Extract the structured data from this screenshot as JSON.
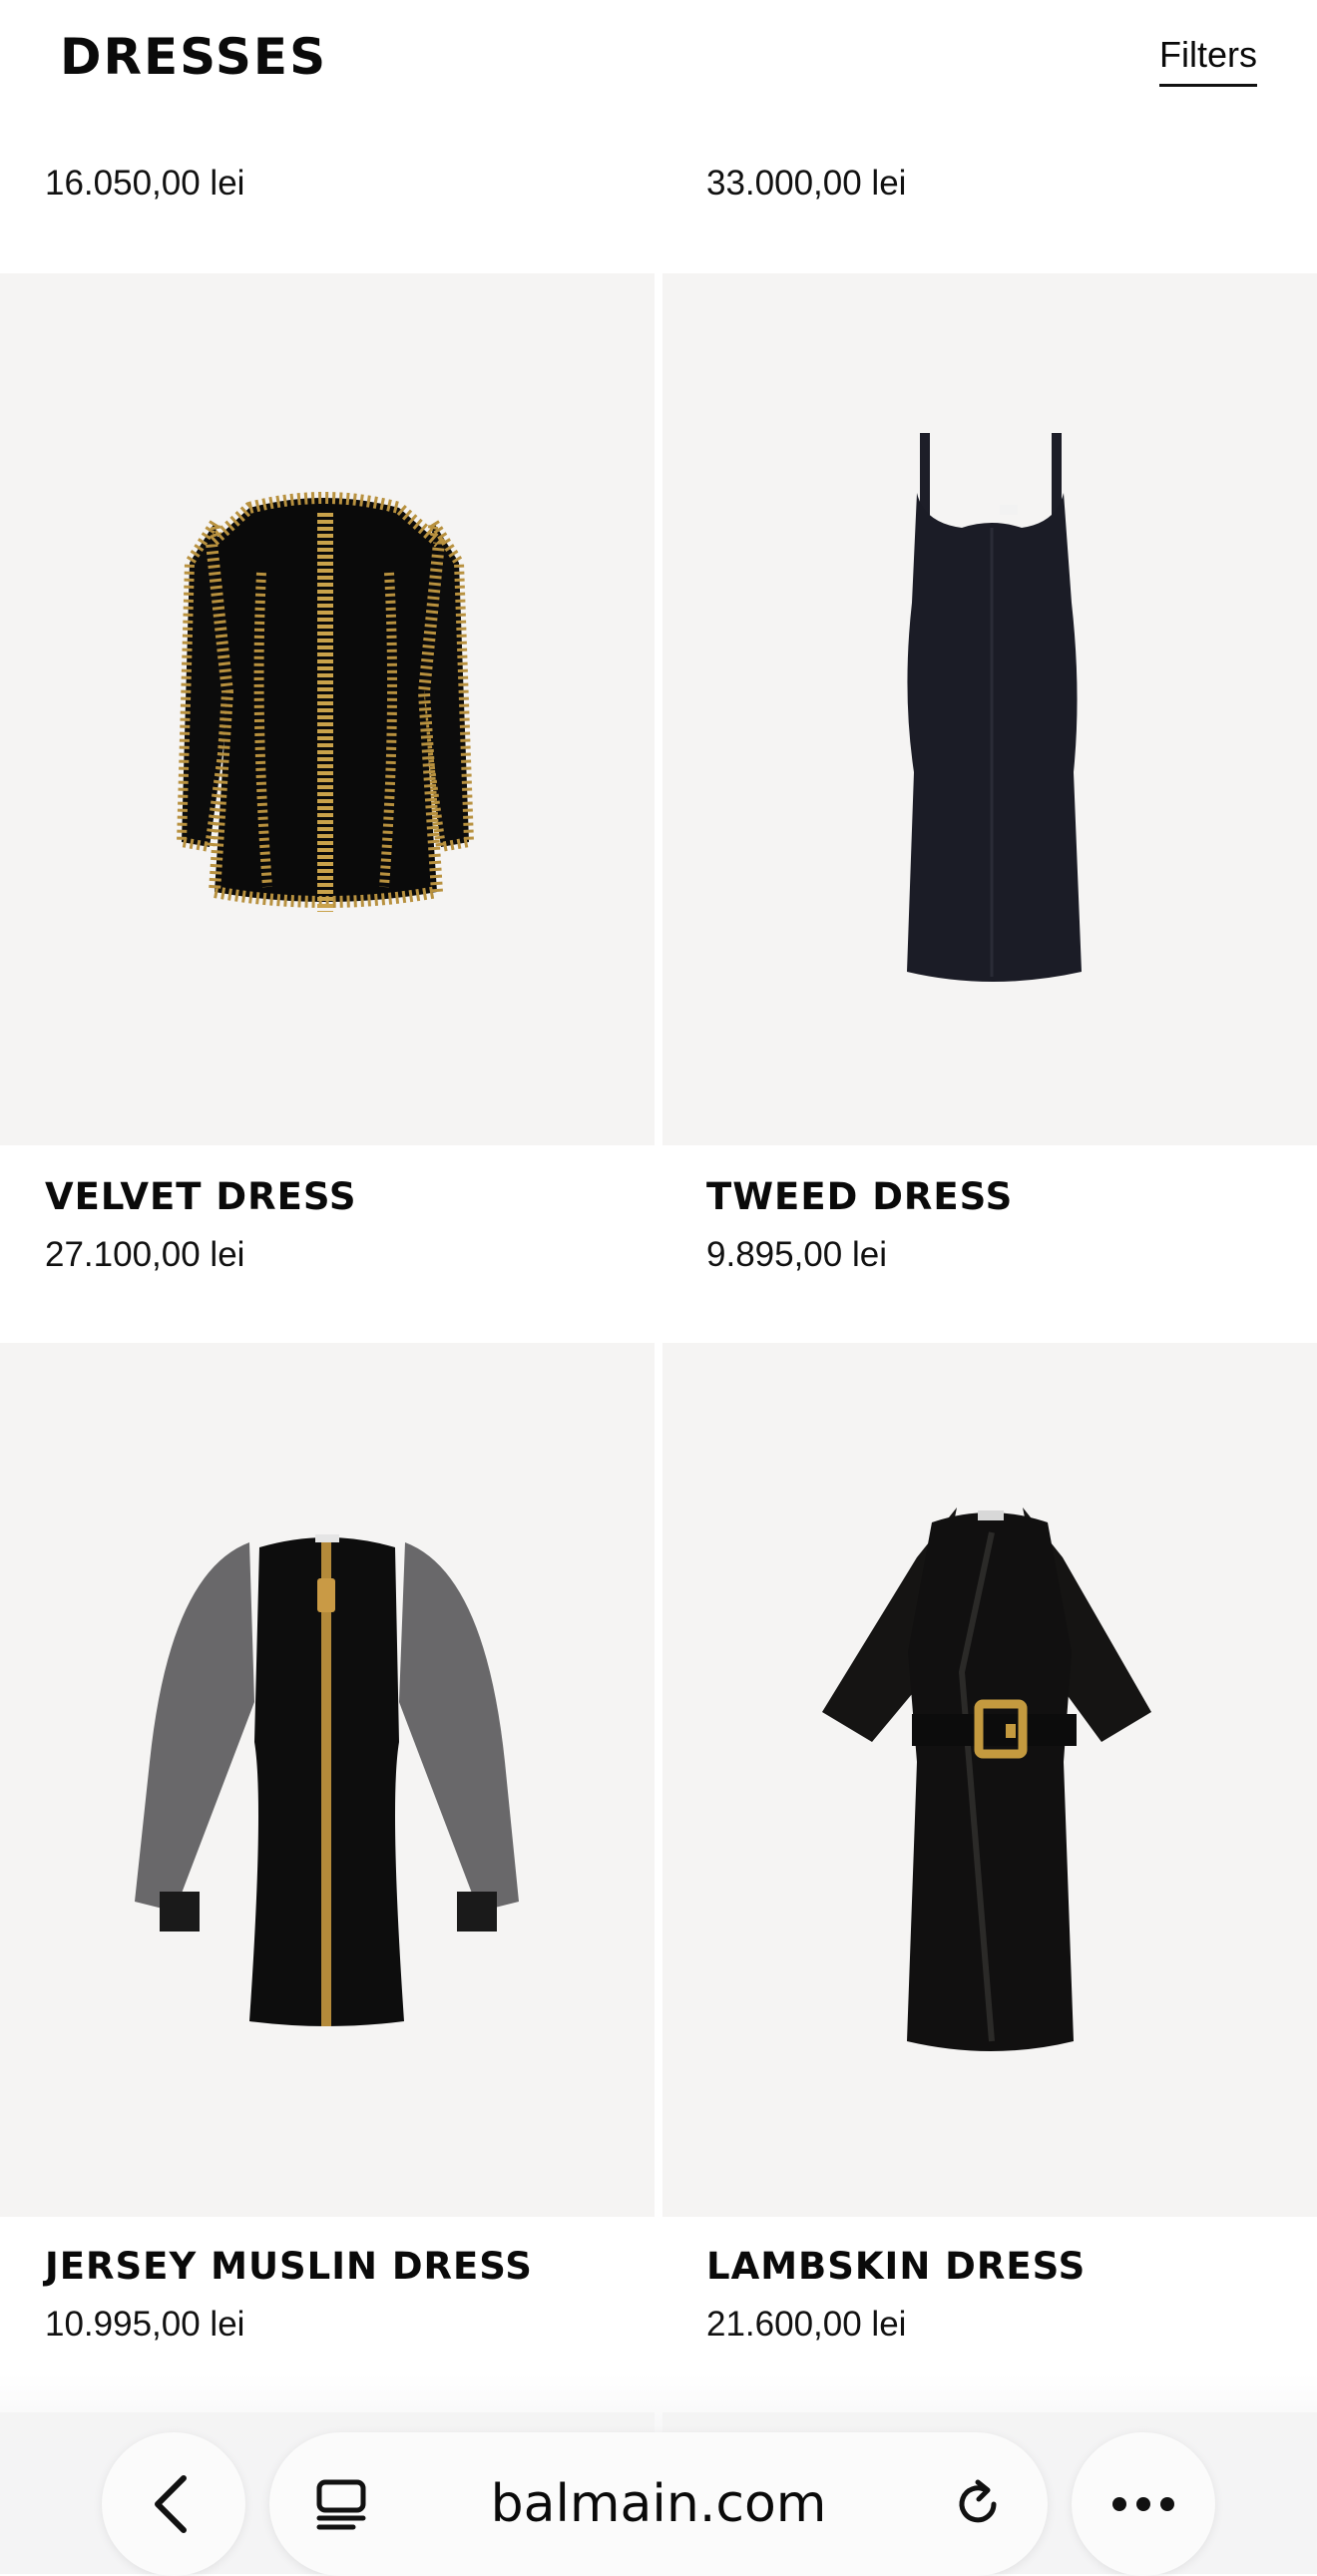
{
  "header": {
    "title": "DRESSES",
    "filters_label": "Filters"
  },
  "top_row_prices": [
    "16.050,00 lei",
    "33.000,00 lei"
  ],
  "products": [
    {
      "name": "VELVET DRESS",
      "price": "27.100,00 lei"
    },
    {
      "name": "TWEED DRESS",
      "price": "9.895,00 lei"
    },
    {
      "name": "JERSEY MUSLIN DRESS",
      "price": "10.995,00 lei"
    },
    {
      "name": "LAMBSKIN DRESS",
      "price": "21.600,00 lei"
    }
  ],
  "browser": {
    "url": "balmain.com"
  },
  "icons": {
    "back": "chevron-left-icon",
    "tabs": "tabs-icon",
    "reload": "reload-icon",
    "more": "more-icon"
  },
  "colors": {
    "tile_bg": "#f5f4f3",
    "gold": "#c9a24a",
    "text": "#0a0a0a"
  }
}
